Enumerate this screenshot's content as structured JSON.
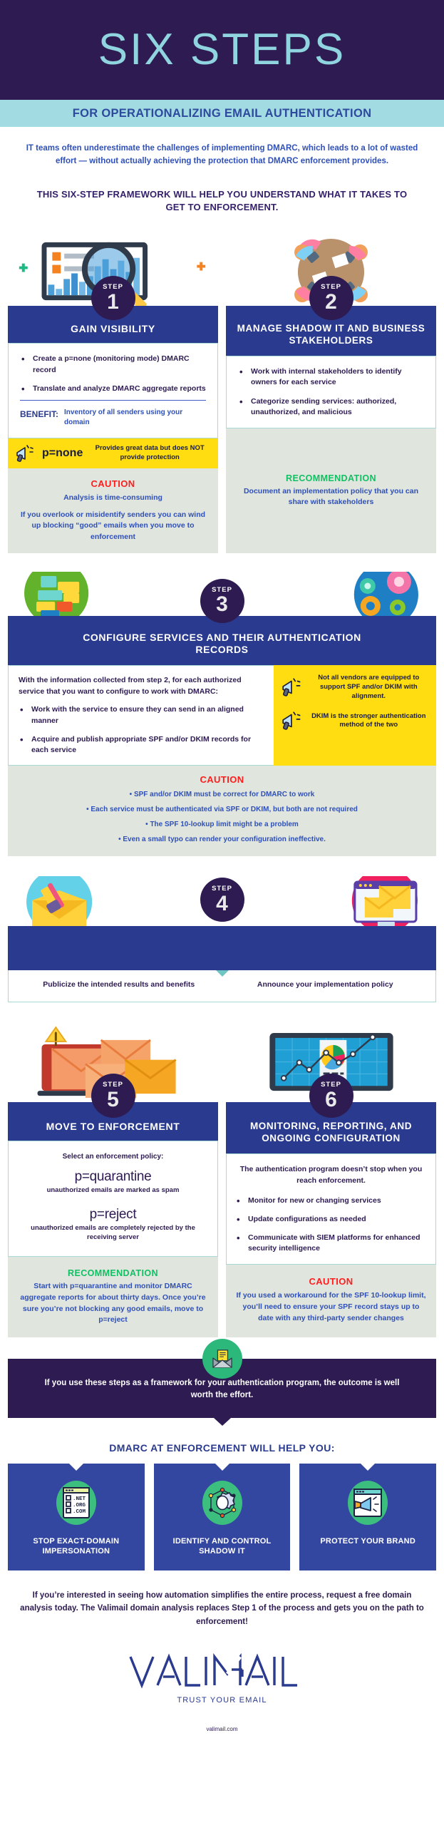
{
  "header": {
    "title": "SIX STEPS",
    "subtitle": "FOR OPERATIONALIZING EMAIL AUTHENTICATION"
  },
  "intro": {
    "paragraph": "IT teams often underestimate the challenges of implementing DMARC, which leads to a lot of wasted effort — without actually achieving the protection that DMARC enforcement provides.",
    "headline": "THIS SIX-STEP FRAMEWORK WILL HELP YOU UNDERSTAND WHAT IT TAKES TO GET TO ENFORCEMENT."
  },
  "step_badge_label": "STEP",
  "steps": [
    {
      "number": "1",
      "title": "GAIN VISIBILITY",
      "bullets": [
        "Create a p=none (monitoring mode) DMARC record",
        "Translate and analyze DMARC aggregate reports"
      ],
      "benefit_label": "BENEFIT:",
      "benefit_text": "Inventory of all senders using your domain",
      "yellow_tag": "p=none",
      "yellow_note": "Provides great data but does NOT provide protection",
      "caution_title": "CAUTION",
      "caution_line1": "Analysis is time-consuming",
      "caution_line2": "If you overlook or misidentify senders you can wind up blocking “good” emails when you move to enforcement"
    },
    {
      "number": "2",
      "title": "MANAGE SHADOW IT AND BUSINESS STAKEHOLDERS",
      "bullets": [
        "Work with internal stakeholders to identify owners for each service",
        "Categorize sending services: authorized, unauthorized, and malicious"
      ],
      "rec_title": "RECOMMENDATION",
      "rec_text": "Document an implementation policy that you can share with stakeholders"
    },
    {
      "number": "3",
      "title": "CONFIGURE SERVICES AND THEIR AUTHENTICATION RECORDS",
      "intro": "With the information collected from step 2, for each authorized service that you want to configure to work with DMARC:",
      "bullets": [
        "Work with the service to ensure they can send in an aligned manner",
        "Acquire and publish appropriate SPF and/or DKIM records for each service"
      ],
      "megaphone_notes": [
        "Not all vendors are equipped to support SPF and/or DKIM with alignment.",
        "DKIM is the stronger authentication method of the two"
      ],
      "caution_title": "CAUTION",
      "caution_lines": [
        "• SPF and/or DKIM must be correct for DMARC to work",
        "• Each service must be authenticated via SPF or DKIM, but both are not required",
        "• The SPF 10-lookup limit might be a problem",
        "• Even a small typo can render your configuration ineffective."
      ]
    },
    {
      "number": "4",
      "title": "",
      "left_text": "Publicize the intended results and benefits",
      "right_text": "Announce your implementation policy"
    },
    {
      "number": "5",
      "title": "MOVE TO ENFORCEMENT",
      "lead": "Select an enforcement policy:",
      "policy1": "p=quarantine",
      "policy1_sub": "unauthorized emails are marked as spam",
      "policy2": "p=reject",
      "policy2_sub": "unauthorized emails are completely rejected by the receiving server",
      "rec_title": "RECOMMENDATION",
      "rec_text": "Start with p=quarantine and monitor DMARC aggregate reports for about thirty days. Once you’re sure you’re not blocking any good emails, move to p=reject"
    },
    {
      "number": "6",
      "title": "MONITORING, REPORTING, AND ONGOING CONFIGURATION",
      "lead": "The authentication program doesn’t stop when you reach enforcement.",
      "bullets": [
        "Monitor for new or changing services",
        "Update configurations as needed",
        "Communicate with SIEM platforms for enhanced security intelligence"
      ],
      "caution_title": "CAUTION",
      "caution_text": "If you used a workaround for the SPF 10-lookup limit, you’ll need to ensure your SPF record stays up to date with any third-party sender changes"
    }
  ],
  "outcome": "If you use these steps as a framework for your authentication program, the outcome is well worth the effort.",
  "benefits": {
    "heading": "DMARC AT ENFORCEMENT WILL HELP YOU:",
    "cards": [
      {
        "label": "STOP EXACT-DOMAIN IMPERSONATION",
        "icon": "domain-list-icon",
        "dns": [
          "​.NET",
          ".ORG",
          ".COM"
        ]
      },
      {
        "label": "IDENTIFY AND CONTROL SHADOW IT",
        "icon": "gear-network-icon"
      },
      {
        "label": "PROTECT YOUR BRAND",
        "icon": "megaphone-browser-icon"
      }
    ]
  },
  "footer": {
    "cta": "If you’re interested in seeing how automation simplifies the entire process, request a free domain analysis today. The Valimail domain analysis replaces Step 1 of the process and gets you on the path to enforcement!",
    "logo": "VALIMAIL",
    "tagline": "TRUST YOUR EMAIL",
    "url": "valimail.com"
  },
  "dns_rows": [
    ".NET",
    ".ORG",
    ".COM"
  ],
  "colors": {
    "dark_purple": "#2d1b52",
    "teal": "#a3dbe2",
    "blue": "#2a3b8f",
    "yellow": "#ffdd10",
    "green": "#13bf63",
    "red": "#ff1d1d"
  }
}
